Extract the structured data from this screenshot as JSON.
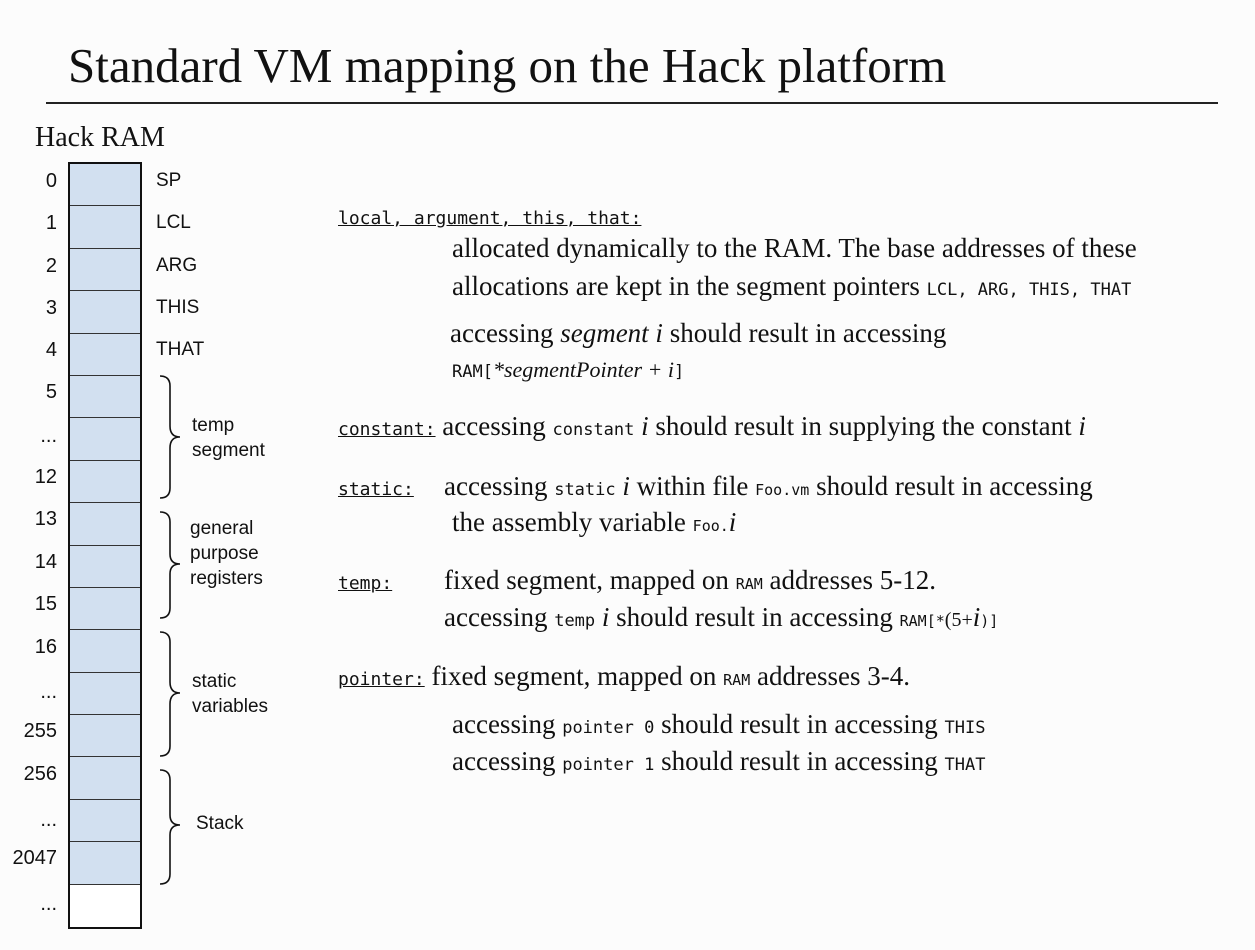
{
  "title": "Standard VM mapping on the Hack platform",
  "ram": {
    "title": "Hack RAM",
    "addresses": [
      "0",
      "1",
      "2",
      "3",
      "4",
      "5",
      "...",
      "12",
      "13",
      "14",
      "15",
      "16",
      "...",
      "255",
      "256",
      "...",
      "2047",
      "..."
    ],
    "registers": [
      "SP",
      "LCL",
      "ARG",
      "THIS",
      "THAT"
    ],
    "segments": {
      "temp": [
        "temp",
        "segment"
      ],
      "gp": [
        "general",
        "purpose",
        "registers"
      ],
      "static": [
        "static",
        "variables"
      ],
      "stack": [
        "Stack"
      ]
    },
    "cell_color": "#d2e0f0"
  },
  "rules": {
    "lat": {
      "keyword": "local, argument, this, that:",
      "l1": "allocated dynamically to the RAM. The base addresses of these",
      "l2a": "allocations are kept in the segment pointers ",
      "l2b": "LCL, ARG, THIS, THAT",
      "l3a": "accessing ",
      "l3b": "segment i",
      "l3c": " should result in accessing",
      "l4a": "RAM[",
      "l4b": "*segmentPointer + i",
      "l4c": "]"
    },
    "constant": {
      "keyword": "constant:",
      "a": " accessing ",
      "b": "constant",
      "c": " i",
      "d": " should result in supplying the constant ",
      "e": "i"
    },
    "static": {
      "keyword": "static:",
      "a": "accessing ",
      "b": "static",
      "c": " i",
      "d": " within file ",
      "e": "Foo.vm",
      "f": " should result in accessing",
      "g": "the assembly variable ",
      "h": "Foo.",
      "i": "i"
    },
    "temp": {
      "keyword": "temp:",
      "a": "fixed segment, mapped on ",
      "b": "RAM",
      "c": " addresses 5-12.",
      "d": "accessing ",
      "e": "temp",
      "f": " i",
      "g": " should result in accessing ",
      "h": "RAM[*",
      "i": "(5+",
      "j": "i",
      "k": ")]"
    },
    "pointer": {
      "keyword": "pointer:",
      "a": " fixed segment, mapped on ",
      "b": "RAM",
      "c": " addresses 3-4.",
      "d": "accessing ",
      "e": "pointer 0",
      "f": " should result in accessing ",
      "g": "THIS",
      "h": "accessing ",
      "i": "pointer 1",
      "j": " should result in accessing ",
      "k": "THAT"
    }
  }
}
